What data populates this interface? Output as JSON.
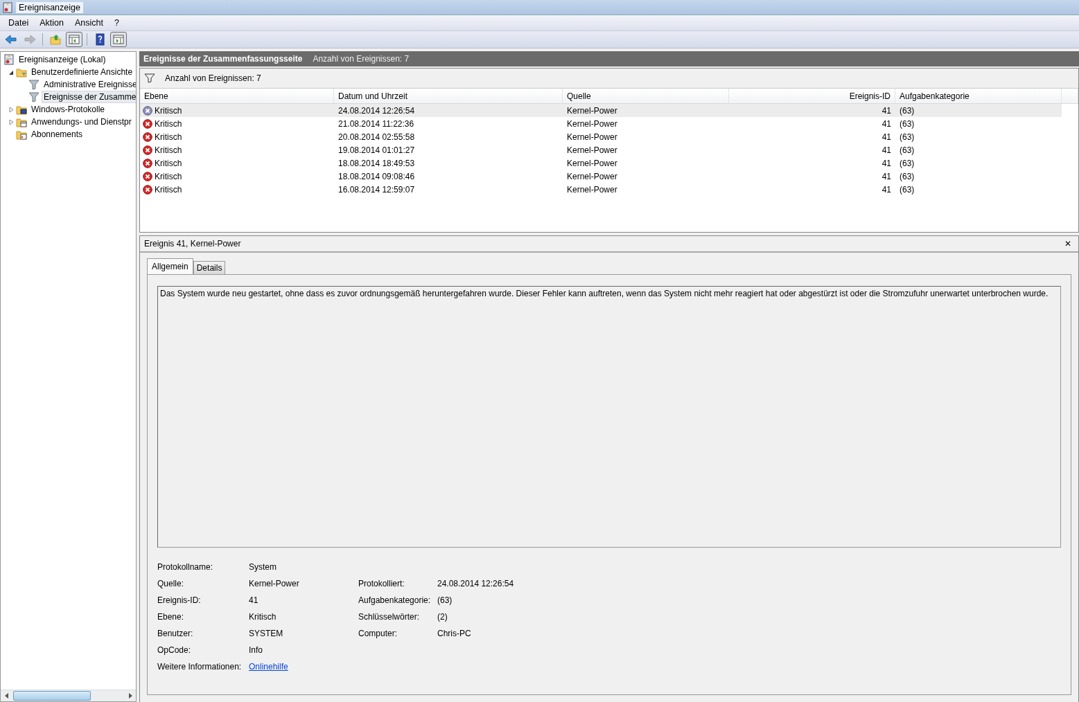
{
  "window": {
    "title": "Ereignisanzeige"
  },
  "menu": [
    "Datei",
    "Aktion",
    "Ansicht",
    "?"
  ],
  "toolbar": [
    {
      "kind": "back",
      "disabled": false,
      "pressed": false
    },
    {
      "kind": "forward",
      "disabled": true,
      "pressed": false
    },
    {
      "kind": "separator"
    },
    {
      "kind": "up",
      "disabled": false,
      "pressed": false
    },
    {
      "kind": "tree-pane",
      "disabled": false,
      "pressed": true
    },
    {
      "kind": "separator"
    },
    {
      "kind": "help",
      "disabled": false,
      "pressed": false
    },
    {
      "kind": "action-pane",
      "disabled": false,
      "pressed": true
    }
  ],
  "tree": [
    {
      "label": "Ereignisanzeige (Lokal)",
      "kind": "viewer",
      "selected": false,
      "children": [
        {
          "label": "Benutzerdefinierte Ansichte",
          "kind": "folder-filter",
          "selected": false,
          "expanded": true,
          "children": [
            {
              "label": "Administrative Ereignisse",
              "kind": "filter",
              "selected": false
            },
            {
              "label": "Ereignisse der Zusamme",
              "kind": "filter",
              "selected": true
            }
          ]
        },
        {
          "label": "Windows-Protokolle",
          "kind": "folder-monitor",
          "selected": false,
          "expanded": false
        },
        {
          "label": "Anwendungs- und Dienstpr",
          "kind": "folder-window",
          "selected": false,
          "expanded": false
        },
        {
          "label": "Abonnements",
          "kind": "folder-calendar",
          "selected": false
        }
      ]
    }
  ],
  "header": {
    "title": "Ereignisse der Zusammenfassungsseite",
    "count": "Anzahl von Ereignissen: 7"
  },
  "filter_bar": {
    "text": "Anzahl von Ereignissen: 7"
  },
  "table": {
    "columns": [
      "Ebene",
      "Datum und Uhrzeit",
      "Quelle",
      "Ereignis-ID",
      "Aufgabenkategorie"
    ],
    "rows": [
      {
        "level": "Kritisch",
        "date": "24.08.2014 12:26:54",
        "source": "Kernel-Power",
        "id": "41",
        "category": "(63)",
        "selected": true
      },
      {
        "level": "Kritisch",
        "date": "21.08.2014 11:22:36",
        "source": "Kernel-Power",
        "id": "41",
        "category": "(63)",
        "selected": false
      },
      {
        "level": "Kritisch",
        "date": "20.08.2014 02:55:58",
        "source": "Kernel-Power",
        "id": "41",
        "category": "(63)",
        "selected": false
      },
      {
        "level": "Kritisch",
        "date": "19.08.2014 01:01:27",
        "source": "Kernel-Power",
        "id": "41",
        "category": "(63)",
        "selected": false
      },
      {
        "level": "Kritisch",
        "date": "18.08.2014 18:49:53",
        "source": "Kernel-Power",
        "id": "41",
        "category": "(63)",
        "selected": false
      },
      {
        "level": "Kritisch",
        "date": "18.08.2014 09:08:46",
        "source": "Kernel-Power",
        "id": "41",
        "category": "(63)",
        "selected": false
      },
      {
        "level": "Kritisch",
        "date": "16.08.2014 12:59:07",
        "source": "Kernel-Power",
        "id": "41",
        "category": "(63)",
        "selected": false
      }
    ]
  },
  "detail": {
    "title": "Ereignis 41, Kernel-Power",
    "close": "✕",
    "tabs": [
      {
        "label": "Allgemein",
        "selected": true
      },
      {
        "label": "Details",
        "selected": false
      }
    ],
    "description": "Das System wurde neu gestartet, ohne dass es zuvor ordnungsgemäß heruntergefahren wurde. Dieser Fehler kann auftreten, wenn das System nicht mehr reagiert hat oder abgestürzt ist oder die Stromzufuhr unerwartet unterbrochen wurde.",
    "fields": [
      {
        "label": "Protokollname:",
        "value": "System"
      },
      {
        "label": "Quelle:",
        "value": "Kernel-Power",
        "label_2": "Protokolliert:",
        "value_2": "24.08.2014 12:26:54"
      },
      {
        "label": "Ereignis-ID:",
        "value": "41",
        "label_2": "Aufgabenkategorie:",
        "value_2": "(63)"
      },
      {
        "label": "Ebene:",
        "value": "Kritisch",
        "label_2": "Schlüsselwörter:",
        "value_2": "(2)"
      },
      {
        "label": "Benutzer:",
        "value": "SYSTEM",
        "label_2": "Computer:",
        "value_2": "Chris-PC"
      },
      {
        "label": "OpCode:",
        "value": "Info"
      },
      {
        "label": "Weitere Informationen:",
        "link": "Onlinehilfe"
      }
    ]
  }
}
